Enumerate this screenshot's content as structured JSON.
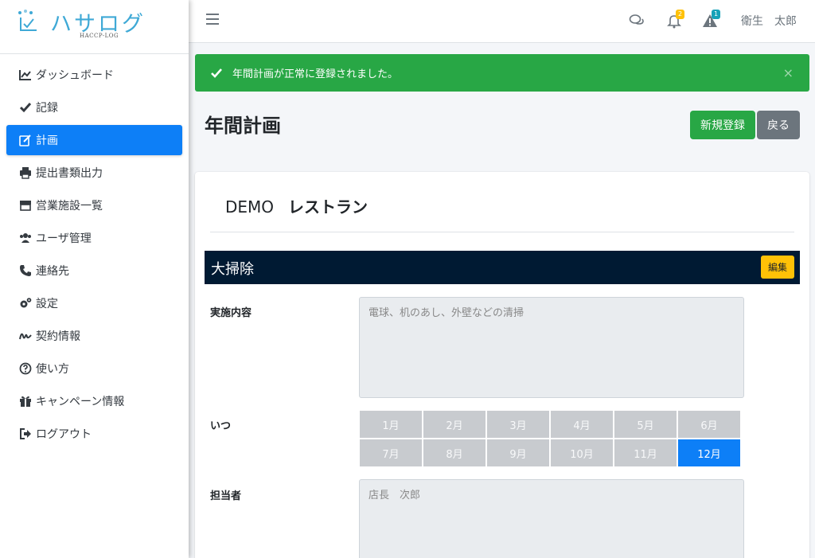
{
  "brand": {
    "name": "ハサログ",
    "sub": "HACCP-LOG"
  },
  "sidebar": {
    "items": [
      {
        "label": "ダッシュボード",
        "icon": "chart-line-icon",
        "active": false
      },
      {
        "label": "記録",
        "icon": "check-icon",
        "active": false
      },
      {
        "label": "計画",
        "icon": "edit-icon",
        "active": true
      },
      {
        "label": "提出書類出力",
        "icon": "print-icon",
        "active": false
      },
      {
        "label": "営業施設一覧",
        "icon": "store-icon",
        "active": false
      },
      {
        "label": "ユーザ管理",
        "icon": "users-icon",
        "active": false
      },
      {
        "label": "連絡先",
        "icon": "phone-icon",
        "active": false
      },
      {
        "label": "設定",
        "icon": "cogs-icon",
        "active": false
      },
      {
        "label": "契約情報",
        "icon": "signature-icon",
        "active": false
      },
      {
        "label": "使い方",
        "icon": "question-circle-icon",
        "active": false
      },
      {
        "label": "キャンペーン情報",
        "icon": "gift-icon",
        "active": false
      },
      {
        "label": "ログアウト",
        "icon": "sign-out-icon",
        "active": false
      }
    ]
  },
  "topbar": {
    "notifications_count": "2",
    "warnings_count": "1",
    "user_name": "衛生　太郎",
    "colors": {
      "notifications_badge": "#ffc107",
      "warnings_badge": "#17a2b8"
    }
  },
  "alert": {
    "message": "年間計画が正常に登録されました。",
    "close": "×"
  },
  "page": {
    "title": "年間計画",
    "new_button": "新規登録",
    "back_button": "戻る"
  },
  "card": {
    "shop_prefix": "DEMO",
    "shop_name": "レストラン",
    "section_title": "大掃除",
    "edit_button": "編集",
    "content_label": "実施内容",
    "content_value": "電球、机のあし、外壁などの清掃",
    "when_label": "いつ",
    "months": [
      {
        "label": "1月",
        "selected": false
      },
      {
        "label": "2月",
        "selected": false
      },
      {
        "label": "3月",
        "selected": false
      },
      {
        "label": "4月",
        "selected": false
      },
      {
        "label": "5月",
        "selected": false
      },
      {
        "label": "6月",
        "selected": false
      },
      {
        "label": "7月",
        "selected": false
      },
      {
        "label": "8月",
        "selected": false
      },
      {
        "label": "9月",
        "selected": false
      },
      {
        "label": "10月",
        "selected": false
      },
      {
        "label": "11月",
        "selected": false
      },
      {
        "label": "12月",
        "selected": true
      }
    ],
    "person_label": "担当者",
    "person_value": "店長　次郎"
  },
  "colors": {
    "primary": "#0d7ff7",
    "success": "#28a745",
    "secondary": "#6c757d",
    "warning": "#ffc107",
    "section_bar": "#001a33",
    "brand": "#3fa9d6"
  }
}
